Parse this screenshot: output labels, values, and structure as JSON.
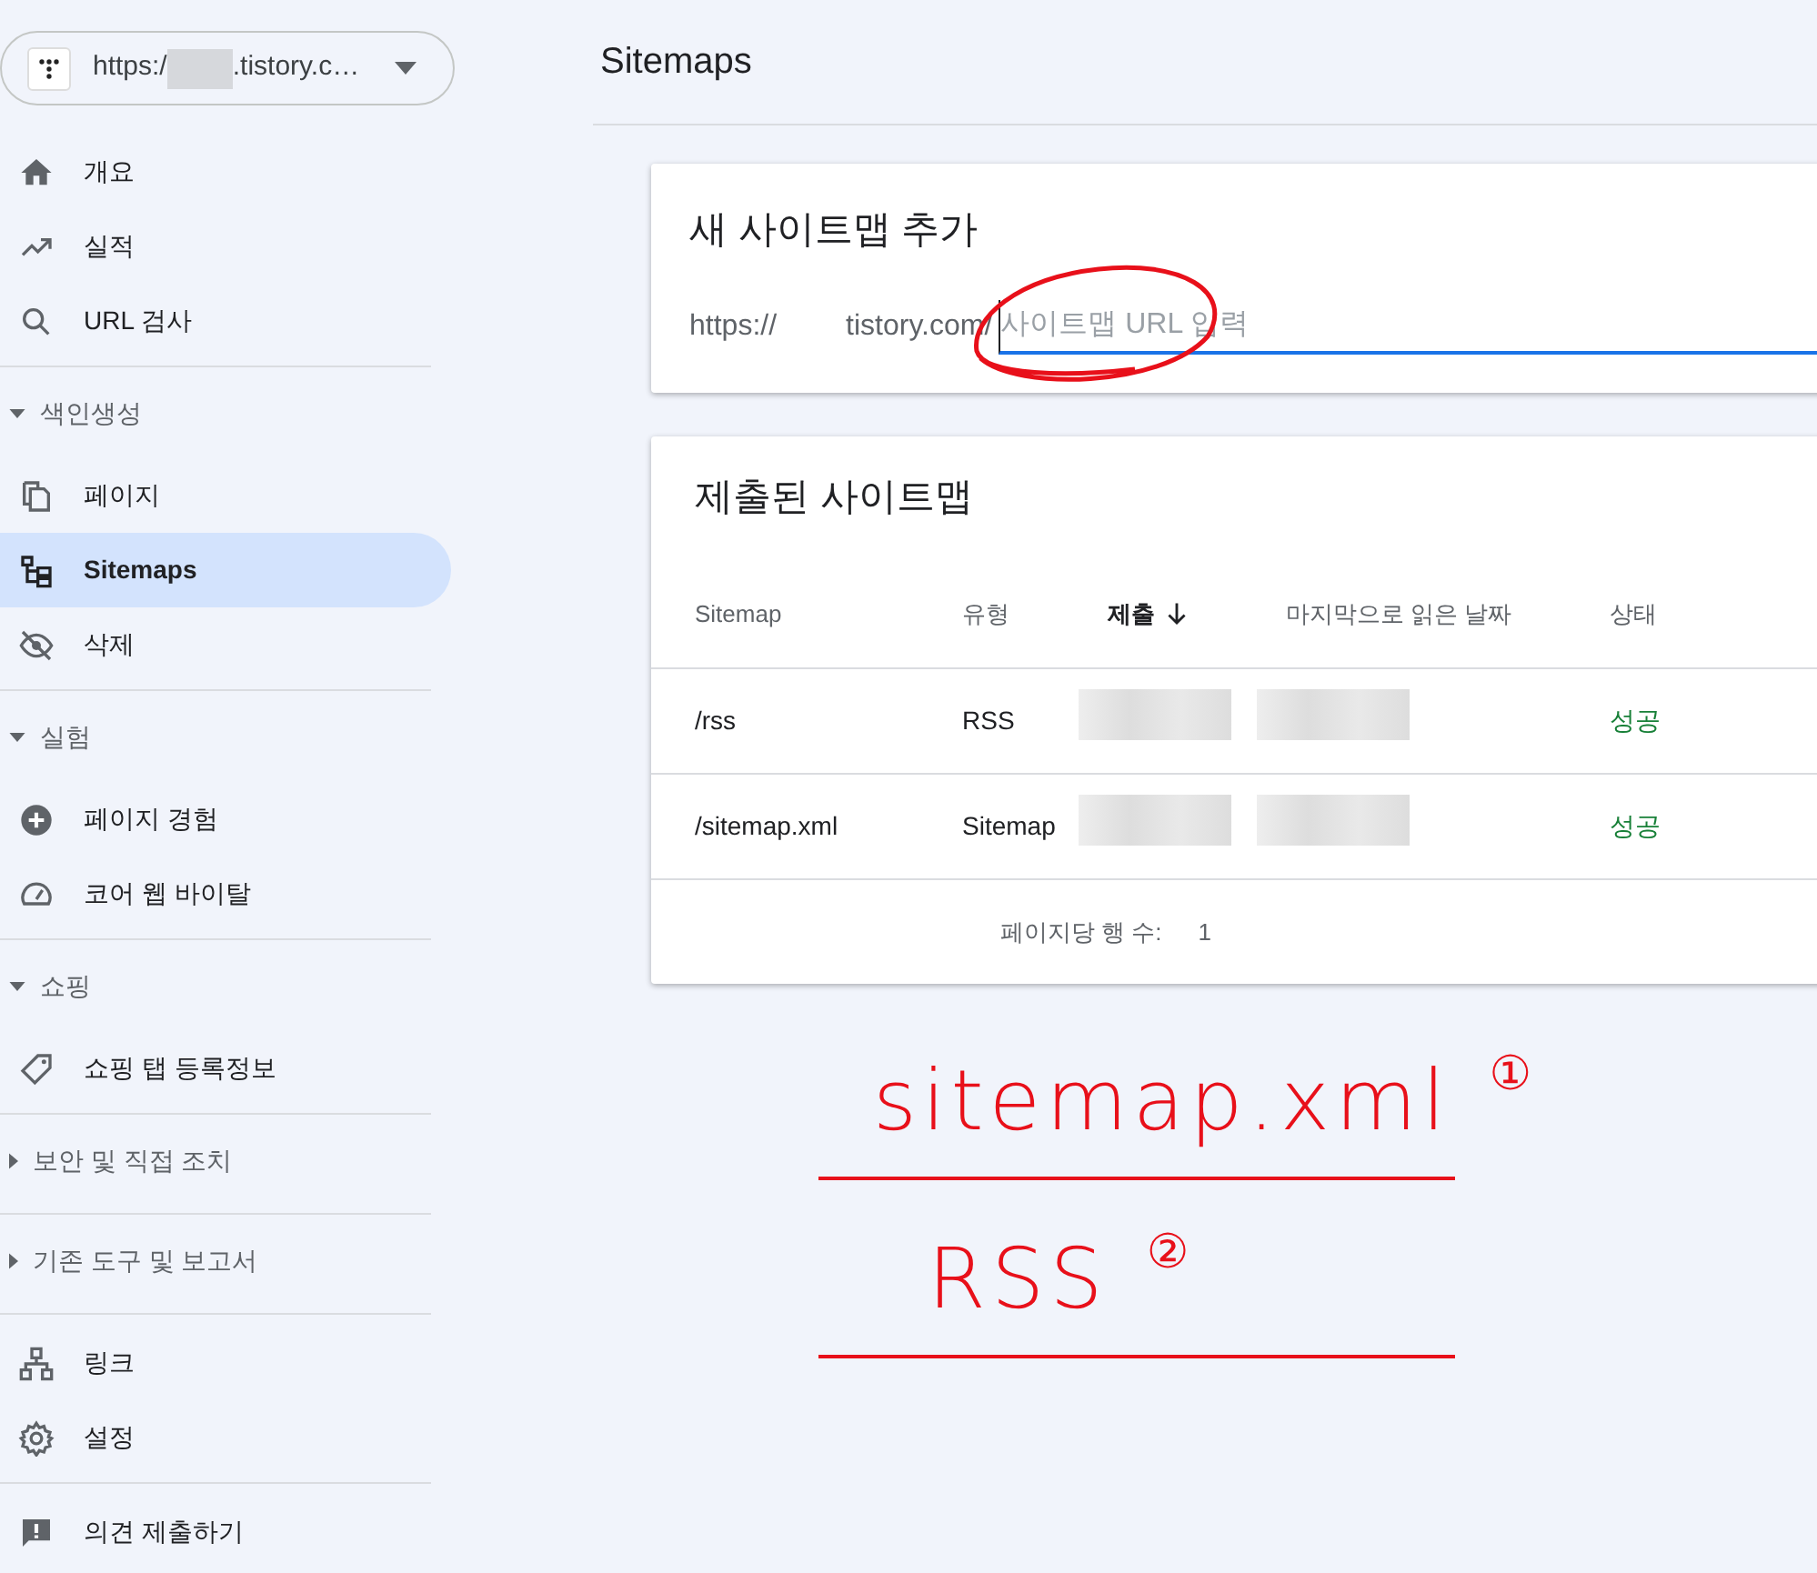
{
  "property_selector": {
    "prefix": "https:/",
    "suffix": ".tistory.c…"
  },
  "sidebar": {
    "groups": [
      {
        "items": [
          {
            "label": "개요",
            "selected": false
          },
          {
            "label": "실적",
            "selected": false
          },
          {
            "label": "URL 검사",
            "selected": false
          }
        ]
      },
      {
        "heading": {
          "label": "색인생성",
          "expanded": true
        },
        "items": [
          {
            "label": "페이지",
            "selected": false
          },
          {
            "label": "Sitemaps",
            "selected": true
          },
          {
            "label": "삭제",
            "selected": false
          }
        ]
      },
      {
        "heading": {
          "label": "실험",
          "expanded": true
        },
        "items": [
          {
            "label": "페이지 경험",
            "selected": false
          },
          {
            "label": "코어 웹 바이탈",
            "selected": false
          }
        ]
      },
      {
        "heading": {
          "label": "쇼핑",
          "expanded": true
        },
        "items": [
          {
            "label": "쇼핑 탭 등록정보",
            "selected": false
          }
        ]
      },
      {
        "heading": {
          "label": "보안 및 직접 조치",
          "expanded": false
        }
      },
      {
        "heading": {
          "label": "기존 도구 및 보고서",
          "expanded": false
        }
      },
      {
        "items": [
          {
            "label": "링크",
            "selected": false
          },
          {
            "label": "설정",
            "selected": false
          }
        ]
      },
      {
        "items": [
          {
            "label": "의견 제출하기",
            "selected": false
          }
        ]
      }
    ]
  },
  "page_title": "Sitemaps",
  "add_card": {
    "title": "새 사이트맵 추가",
    "prefix": "https://",
    "domain": "tistory.com/",
    "placeholder": "사이트맵 URL 입력"
  },
  "submitted_card": {
    "title": "제출된 사이트맵",
    "columns": [
      {
        "label": "Sitemap",
        "sorted": false
      },
      {
        "label": "유형",
        "sorted": false
      },
      {
        "label": "제출",
        "sorted": true
      },
      {
        "label": "마지막으로 읽은 날짜",
        "sorted": false
      },
      {
        "label": "상태",
        "sorted": false
      }
    ],
    "rows": [
      {
        "sitemap": "/rss",
        "type": "RSS",
        "status": "성공"
      },
      {
        "sitemap": "/sitemap.xml",
        "type": "Sitemap",
        "status": "성공"
      }
    ],
    "rows_per_page_label": "페이지당 행 수:",
    "rows_per_page": "1"
  },
  "annotations": [
    {
      "text": "sitemap.xml",
      "mark": "①"
    },
    {
      "text": "RSS",
      "mark": "②"
    }
  ]
}
